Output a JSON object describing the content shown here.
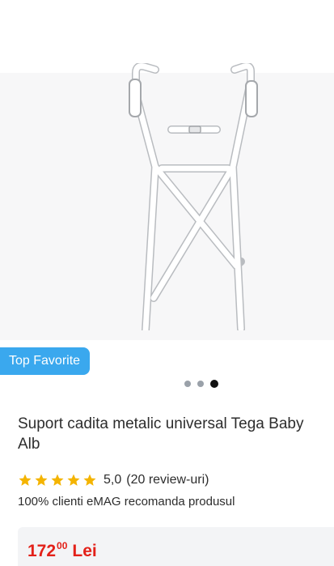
{
  "product": {
    "badge": "Top Favorite",
    "title": "Suport cadita metalic universal Tega Baby Alb",
    "rating": {
      "value": "5,0",
      "reviews": "(20 review-uri)",
      "stars": 5
    },
    "recommendation": "100% clienti eMAG recomanda produsul",
    "price": {
      "integer": "172",
      "decimals": "00",
      "currency": "Lei"
    }
  },
  "gallery": {
    "total_images": 3,
    "active_index": 2
  },
  "colors": {
    "badge": "#3aa8ee",
    "price": "#e32119",
    "star": "#f4b400"
  }
}
